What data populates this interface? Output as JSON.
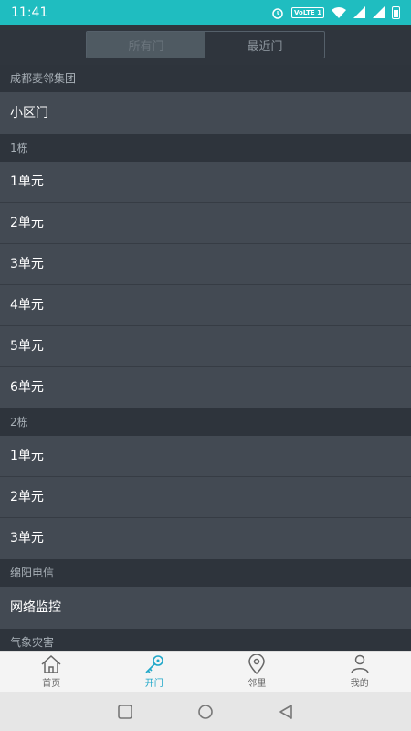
{
  "status_bar": {
    "time": "11:41",
    "volte": "VoLTE 1"
  },
  "tabs": {
    "all": "所有门",
    "recent": "最近门",
    "active": "all"
  },
  "groups": [
    {
      "header": "成都麦邻集团",
      "items": [
        "小区门"
      ]
    },
    {
      "header": "1栋",
      "items": [
        "1单元",
        "2单元",
        "3单元",
        "4单元",
        "5单元",
        "6单元"
      ]
    },
    {
      "header": "2栋",
      "items": [
        "1单元",
        "2单元",
        "3单元"
      ]
    },
    {
      "header": "绵阳电信",
      "items": [
        "网络监控"
      ]
    },
    {
      "header": "气象灾害",
      "items": []
    }
  ],
  "bottom_nav": [
    {
      "label": "首页",
      "icon": "home-icon",
      "active": false
    },
    {
      "label": "开门",
      "icon": "key-icon",
      "active": true
    },
    {
      "label": "邻里",
      "icon": "location-pin-icon",
      "active": false
    },
    {
      "label": "我的",
      "icon": "user-icon",
      "active": false
    }
  ],
  "colors": {
    "status_bar": "#1fbdc0",
    "accent": "#1fa7c9",
    "row_bg": "#434a53",
    "header_bg": "#2e343c"
  }
}
